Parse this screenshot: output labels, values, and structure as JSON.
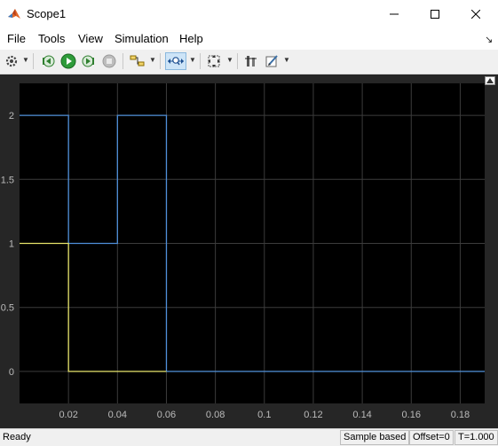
{
  "window": {
    "title": "Scope1"
  },
  "menu": {
    "items": [
      "File",
      "Tools",
      "View",
      "Simulation",
      "Help"
    ]
  },
  "toolbar": {
    "icons": [
      "settings-icon",
      "step-back-icon",
      "run-icon",
      "step-forward-icon",
      "stop-icon",
      "highlight-block-icon",
      "zoom-time-icon",
      "fit-to-view-icon",
      "cursor-measurements-icon",
      "style-icon"
    ]
  },
  "status": {
    "ready": "Ready",
    "sample": "Sample based",
    "offset": "Offset=0",
    "time": "T=1.000"
  },
  "colors": {
    "plot_background": "#000000",
    "frame_background": "#262626",
    "grid": "#3c3c3c",
    "series_1": "#4f8fd9",
    "series_2": "#e6e36a",
    "tick_text": "#bbbbbb"
  },
  "chart_data": {
    "type": "line",
    "step": true,
    "title": "",
    "xlabel": "",
    "ylabel": "",
    "xlim": [
      0.0,
      0.19
    ],
    "ylim": [
      -0.25,
      2.25
    ],
    "xticks": [
      0.02,
      0.04,
      0.06,
      0.08,
      0.1,
      0.12,
      0.14,
      0.16,
      0.18
    ],
    "xtick_labels": [
      "0.02",
      "0.04",
      "0.06",
      "0.08",
      "0.1",
      "0.12",
      "0.14",
      "0.16",
      "0.18"
    ],
    "yticks": [
      0,
      0.5,
      1,
      1.5,
      2
    ],
    "ytick_labels": [
      "0",
      "0.5",
      "1",
      "1.5",
      "2"
    ],
    "grid": true,
    "series": [
      {
        "color": "#4f8fd9",
        "x": [
          0.0,
          0.02,
          0.02,
          0.04,
          0.04,
          0.06,
          0.06,
          0.19
        ],
        "y": [
          2,
          2,
          1,
          1,
          2,
          2,
          0,
          0
        ]
      },
      {
        "color": "#e6e36a",
        "x": [
          0.0,
          0.02,
          0.02,
          0.06
        ],
        "y": [
          1,
          1,
          0,
          0
        ]
      }
    ]
  }
}
